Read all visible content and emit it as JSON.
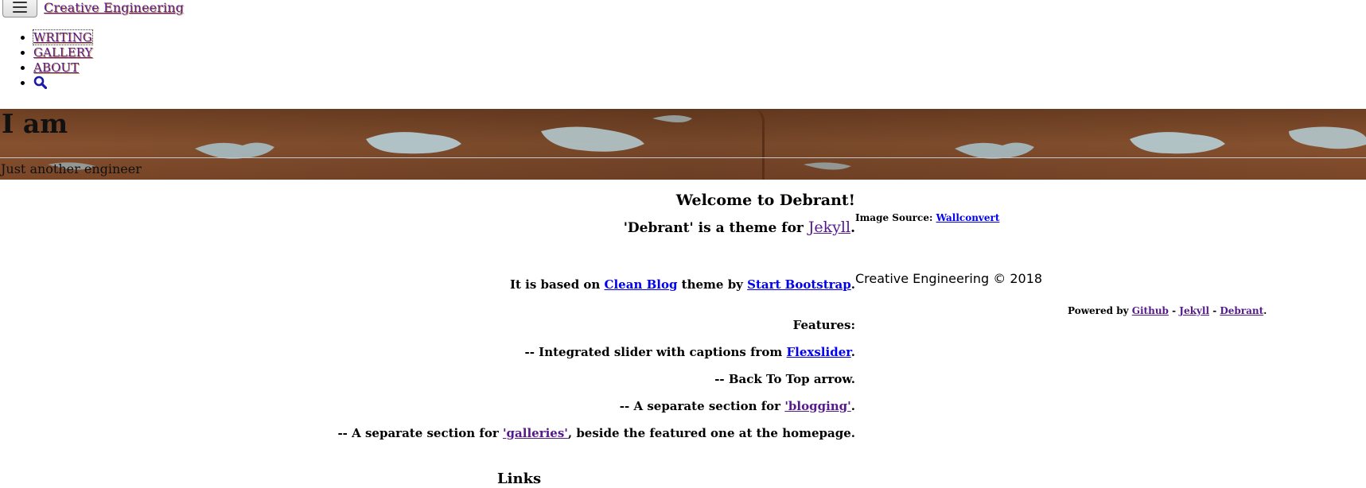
{
  "nav": {
    "brand": "Creative Engineering",
    "items": [
      {
        "label": "WRITING"
      },
      {
        "label": "GALLERY"
      },
      {
        "label": "ABOUT"
      }
    ],
    "search_icon": "search-icon"
  },
  "header": {
    "title": "I am",
    "subtitle": "Just another engineer"
  },
  "main": {
    "welcome": "Welcome to Debrant!",
    "theme_prefix": "'Debrant' is a theme for ",
    "theme_link": "Jekyll",
    "period": ".",
    "based_prefix": "It is based on ",
    "based_link1": "Clean Blog",
    "based_mid": " theme by ",
    "based_link2": "Start Bootstrap",
    "features_label": "Features:",
    "feature1_prefix": "-- Integrated slider with captions from ",
    "feature1_link": "Flexslider",
    "feature2": "-- Back To Top arrow.",
    "feature3_prefix": "-- A separate section for ",
    "feature3_link": "'blogging'",
    "feature4_prefix": "-- A separate section for ",
    "feature4_link": "'galleries'",
    "feature4_suffix": ", beside the featured one at the homepage.",
    "links_heading": "Links"
  },
  "side": {
    "image_source_label": "Image Source: ",
    "image_source_link": "Wallconvert"
  },
  "footer": {
    "copyright": "Creative Engineering © 2018",
    "powered_prefix": "Powered by ",
    "link_github": "Github",
    "sep": " - ",
    "link_jekyll": "Jekyll",
    "link_debrant": "Debrant",
    "end": "."
  }
}
